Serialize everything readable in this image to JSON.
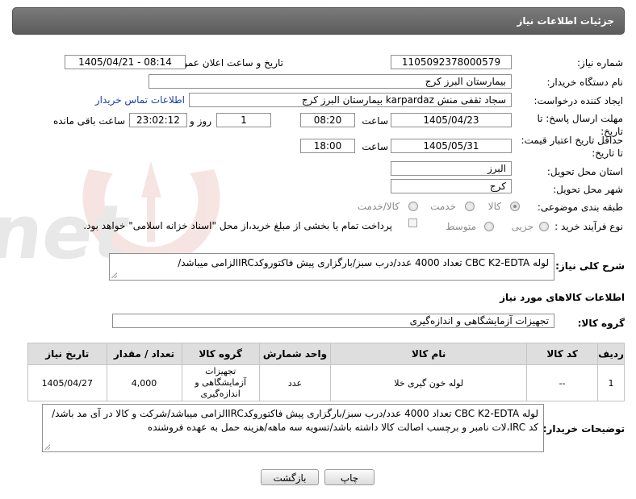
{
  "header": {
    "title": "جزئیات اطلاعات نیاز"
  },
  "fields": {
    "need_number_label": "شماره نیاز:",
    "need_number": "1105092378000579",
    "announce_label": "تاریخ و ساعت اعلان عمومی:",
    "announce_value": "1405/04/21 - 08:14",
    "buyer_org_label": "نام دستگاه خریدار:",
    "buyer_org": "بیمارستان البرز کرج",
    "creator_label": "ایجاد کننده درخواست:",
    "creator": "سجاد ثقفی منش karpardaz بیمارستان البرز کرج",
    "buyer_contact_link": "اطلاعات تماس خریدار",
    "reply_deadline_label": "مهلت ارسال پاسخ: تا تاریخ:",
    "reply_date": "1405/04/23",
    "time_label": "ساعت",
    "reply_time": "08:20",
    "days_value": "1",
    "days_label": "روز و",
    "remaining_time": "23:02:12",
    "remaining_label": "ساعت باقی مانده",
    "price_validity_label": "حداقل تاریخ اعتبار قیمت: تا تاریخ:",
    "validity_date": "1405/05/31",
    "validity_time": "18:00",
    "province_label": "استان محل تحویل:",
    "province": "البرز",
    "city_label": "شهر محل تحویل:",
    "city": "کرج",
    "category_label": "طبقه بندی موضوعی:",
    "category_options": [
      "کالا",
      "خدمت",
      "کالا/خدمت"
    ],
    "purchase_type_label": "نوع فرآیند خرید :",
    "purchase_options": [
      "جزیی",
      "متوسط"
    ],
    "payment_note": "پرداخت تمام یا بخشی از مبلغ خرید،از محل \"اسناد خزانه اسلامی\" خواهد بود."
  },
  "summary": {
    "label": "شرح کلی نیاز:",
    "text": "لوله CBC K2-EDTA تعداد 4000 عدد/درب سبز/بارگزاری پیش فاکتوروکدIRCالزامی میباشد/"
  },
  "goods": {
    "section_title": "اطلاعات کالاهای مورد نیاز",
    "group_label": "گروه کالا:",
    "group_value": "تجهیزات آزمایشگاهی و اندازه‌گیری",
    "columns": [
      "ردیف",
      "کد کالا",
      "نام کالا",
      "واحد شمارش",
      "گروه کالا",
      "تعداد / مقدار",
      "تاریخ نیاز"
    ],
    "rows": [
      {
        "row": "1",
        "code": "--",
        "name": "لوله خون گیری خلا",
        "unit": "عدد",
        "group": "تجهیزات آزمایشگاهی و اندازه‌گیری",
        "qty": "4,000",
        "date": "1405/04/27"
      }
    ]
  },
  "buyer_notes": {
    "label": "توضیحات خریدار:",
    "text": "لوله CBC K2-EDTA تعداد 4000 عدد/درب سبز/بارگزاری پیش فاکتوروکدIRCالزامی میباشد/شرکت و کالا در آی مد باشد/کد IRC،لات نامبر و برچسب اصالت کالا داشته باشد/تسویه سه ماهه/هزینه حمل به عهده فروشنده"
  },
  "buttons": {
    "print": "چاپ",
    "back": "بازگشت"
  },
  "watermark": {
    "text": "AriaTender.net"
  }
}
